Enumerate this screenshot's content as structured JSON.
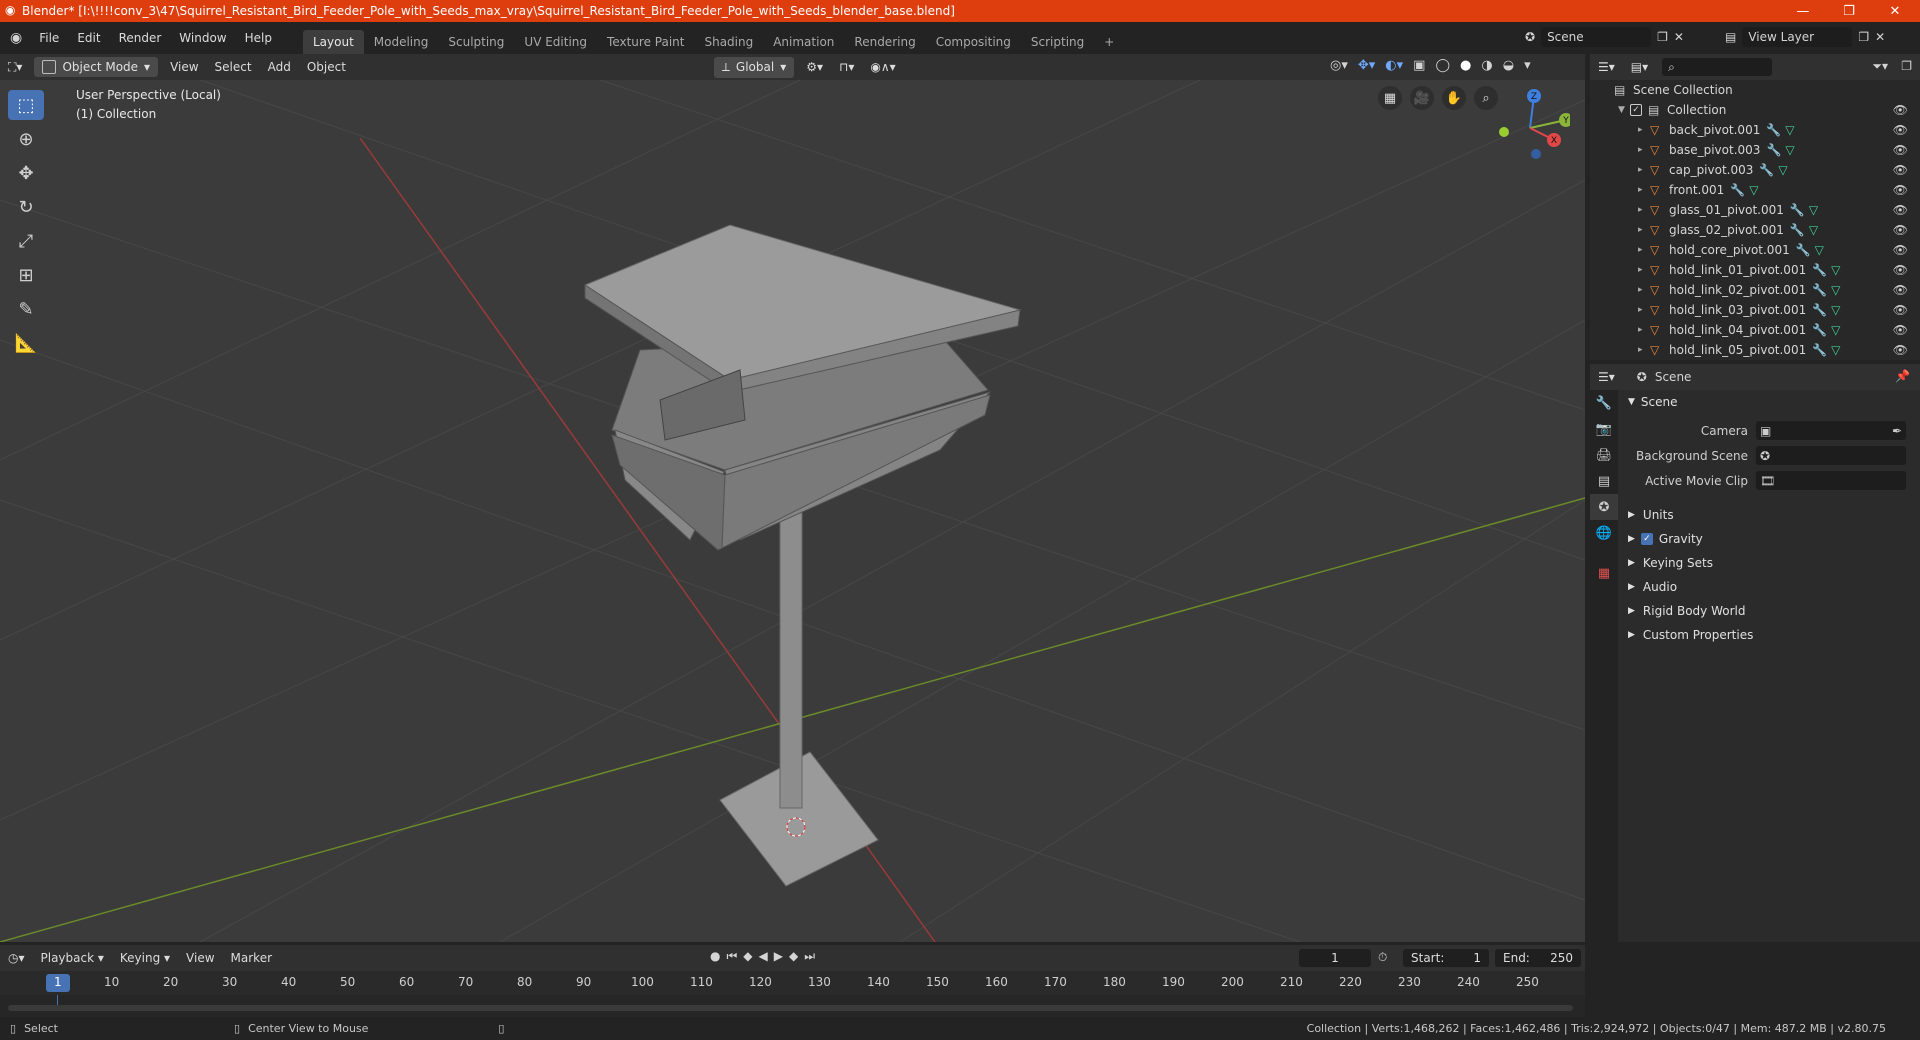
{
  "window": {
    "title": "Blender* [I:\\!!!!conv_3\\47\\Squirrel_Resistant_Bird_Feeder_Pole_with_Seeds_max_vray\\Squirrel_Resistant_Bird_Feeder_Pole_with_Seeds_blender_base.blend]",
    "minimize": "—",
    "maximize": "❐",
    "close": "✕"
  },
  "menus": [
    "File",
    "Edit",
    "Render",
    "Window",
    "Help"
  ],
  "workspaces": [
    "Layout",
    "Modeling",
    "Sculpting",
    "UV Editing",
    "Texture Paint",
    "Shading",
    "Animation",
    "Rendering",
    "Compositing",
    "Scripting"
  ],
  "workspace_add": "+",
  "scene_selector": {
    "value": "Scene"
  },
  "view_layer": {
    "value": "View Layer"
  },
  "viewport_header": {
    "mode": "Object Mode",
    "view": "View",
    "select": "Select",
    "add": "Add",
    "object": "Object",
    "orientation": "Global"
  },
  "viewport_overlay": {
    "line1": "User Perspective (Local)",
    "line2": "(1) Collection"
  },
  "gizmo": {
    "x": "X",
    "y": "Y",
    "z": "Z"
  },
  "outliner": {
    "root": "Scene Collection",
    "collection": "Collection",
    "items": [
      "back_pivot.001",
      "base_pivot.003",
      "cap_pivot.003",
      "front.001",
      "glass_01_pivot.001",
      "glass_02_pivot.001",
      "hold_core_pivot.001",
      "hold_link_01_pivot.001",
      "hold_link_02_pivot.001",
      "hold_link_03_pivot.001",
      "hold_link_04_pivot.001",
      "hold_link_05_pivot.001"
    ]
  },
  "properties": {
    "context": "Scene",
    "panel_scene": "Scene",
    "camera_label": "Camera",
    "background_label": "Background Scene",
    "movieclip_label": "Active Movie Clip",
    "collapsed_panels": [
      "Units",
      "Gravity",
      "Keying Sets",
      "Audio",
      "Rigid Body World",
      "Custom Properties"
    ]
  },
  "timeline": {
    "playback": "Playback",
    "keying": "Keying",
    "view": "View",
    "marker": "Marker",
    "current_frame": "1",
    "start_label": "Start:",
    "start": "1",
    "end_label": "End:",
    "end": "250",
    "ticks": [
      "1",
      "10",
      "20",
      "30",
      "40",
      "50",
      "60",
      "70",
      "80",
      "90",
      "100",
      "110",
      "120",
      "130",
      "140",
      "150",
      "160",
      "170",
      "180",
      "190",
      "200",
      "210",
      "220",
      "230",
      "240",
      "250"
    ]
  },
  "status": {
    "select": "Select",
    "center_view": "Center View to Mouse",
    "stats": "Collection | Verts:1,468,262 | Faces:1,462,486 | Tris:2,924,972 | Objects:0/47 | Mem: 487.2 MB | v2.80.75"
  },
  "colors": {
    "accent": "#4772b3",
    "title_bar": "#de3d0e",
    "object_icon": "#e8873a",
    "mesh_icon": "#3fd09a"
  }
}
